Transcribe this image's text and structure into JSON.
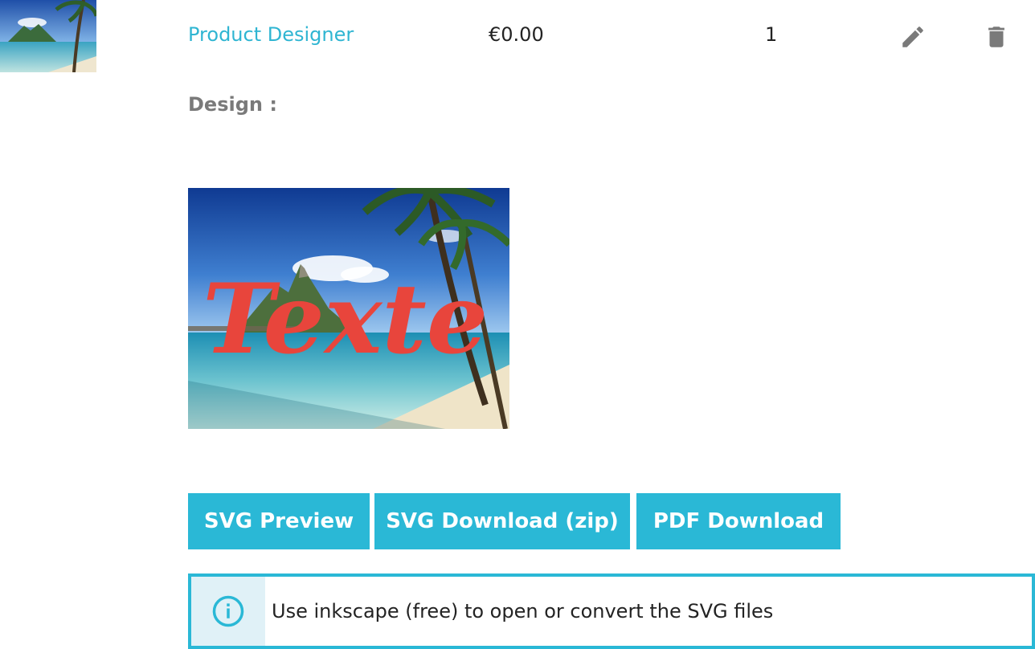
{
  "cart_line": {
    "product_name": "Product Designer",
    "price": "€0.00",
    "quantity": "1",
    "thumbnail_icon": "beach-thumbnail-image",
    "edit_icon": "pencil-icon",
    "delete_icon": "trash-icon"
  },
  "design": {
    "label": "Design :",
    "image_text": "Texte",
    "image_text_color": "#e8453c"
  },
  "buttons": {
    "svg_preview": "SVG Preview",
    "svg_download": "SVG Download (zip)",
    "pdf_download": "PDF Download"
  },
  "info": {
    "icon": "info-circle-icon",
    "message": "Use inkscape (free) to open or convert the SVG files"
  },
  "colors": {
    "accent": "#2ab8d6",
    "link": "#2fb5d2",
    "info_bg": "#e0f1f7",
    "icon_gray": "#7a7a7a"
  }
}
